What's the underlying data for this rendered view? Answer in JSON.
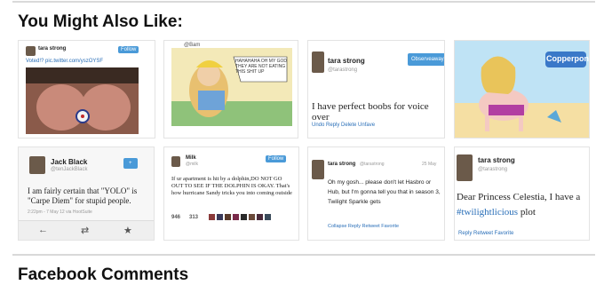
{
  "section": {
    "title": "You Might Also Like:",
    "comments_title": "Facebook Comments"
  },
  "thumbs": {
    "t1": {
      "name": "tara strong",
      "text": "Voted!? pic.twitter.com/yszOYSF",
      "button": "Follow"
    },
    "t2": {
      "handle": "@Bam",
      "bubble": "HAHAHAHA OH MY GOD THEY ARE NOT EATING THIS SHIT UP"
    },
    "t3": {
      "name": "tara strong",
      "handle": "@tarastrong",
      "button": "Observeaway",
      "text": "I have perfect boobs for voice over",
      "actions": "Undo Reply Delete Unfave"
    },
    "t4": {
      "logo": "Copperpony"
    },
    "t5": {
      "name": "Jack Black",
      "handle": "@tenJackBlack",
      "text": "I am fairly certain that \"YOLO\" is \"Carpe Diem\" for stupid people.",
      "meta": "2:22pm - 7 May 12 via HootSuite"
    },
    "t6": {
      "name": "Milk",
      "handle": "@milk",
      "button": "Follow",
      "text": "If ur apartment is hit by a dolphin,DO NOT GO OUT TO SEE IF THE DOLPHIN IS OKAY. That's how hurricane Sandy tricks you into coming outside",
      "stats_retweets": "946",
      "stats_favorites": "313"
    },
    "t7": {
      "name": "tara strong",
      "handle": "@tarastrong",
      "date": "25 May",
      "text": "Oh my gosh... please don't let Hasbro or Hub, but I'm gonna tell you that in season 3, Twilight Sparkle gets",
      "actions": "Collapse Reply Retweet Favorite"
    },
    "t8": {
      "name": "tara strong",
      "handle": "@tarastrong",
      "text": "Dear Princess Celestia, I have a",
      "hashtag": "#twilightlicious",
      "text_end": "plot",
      "actions": "Reply Retweet Favorite"
    }
  },
  "colors": {
    "twitter_blue": "#4a9ad8",
    "link_blue": "#2a6fb8",
    "rule_gray": "#d9d9d9"
  }
}
